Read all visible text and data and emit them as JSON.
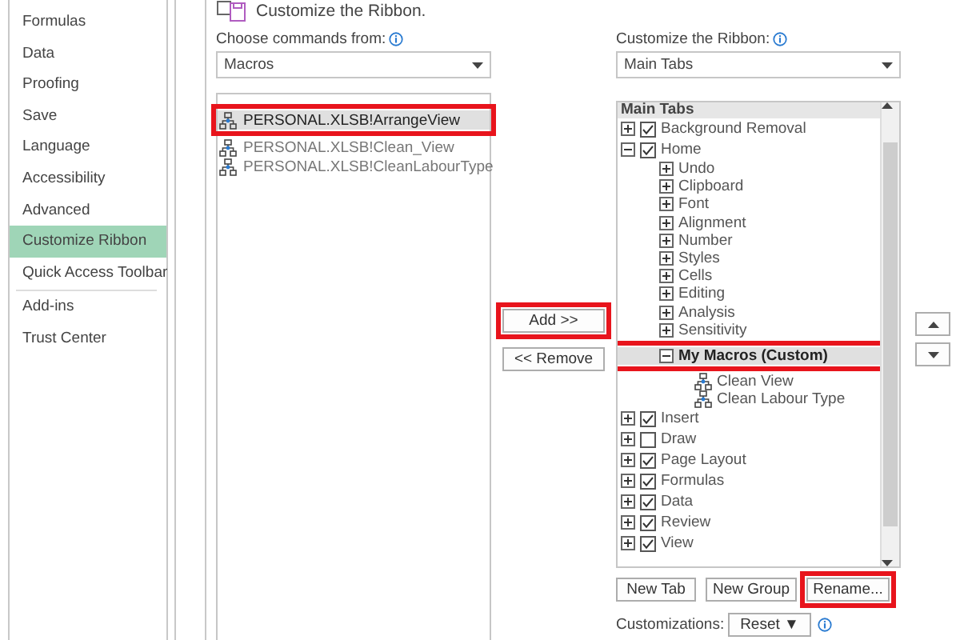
{
  "sidebar": {
    "items": [
      {
        "label": "Formulas",
        "selected": false
      },
      {
        "label": "Data",
        "selected": false
      },
      {
        "label": "Proofing",
        "selected": false
      },
      {
        "label": "Save",
        "selected": false
      },
      {
        "label": "Language",
        "selected": false
      },
      {
        "label": "Accessibility",
        "selected": false
      },
      {
        "label": "Advanced",
        "selected": false
      },
      {
        "label": "Customize Ribbon",
        "selected": true
      },
      {
        "label": "Quick Access Toolbar",
        "selected": false
      },
      {
        "label": "Add-ins",
        "selected": false
      },
      {
        "label": "Trust Center",
        "selected": false
      }
    ]
  },
  "header": {
    "title": "Customize the Ribbon."
  },
  "commands": {
    "label": "Choose commands from:",
    "dropdown": "Macros",
    "items": [
      {
        "label": "PERSONAL.XLSB!ArrangeView",
        "selected": true,
        "highlighted": true
      },
      {
        "label": "PERSONAL.XLSB!Clean_View",
        "selected": false,
        "highlighted": false
      },
      {
        "label": "PERSONAL.XLSB!CleanLabourType",
        "selected": false,
        "highlighted": false
      }
    ]
  },
  "transfer": [
    {
      "label": "Add >>",
      "highlighted": true
    },
    {
      "label": "<< Remove",
      "highlighted": false
    }
  ],
  "ribbon": {
    "label": "Customize the Ribbon:",
    "dropdown": "Main Tabs",
    "tree_header": "Main Tabs",
    "items": [
      {
        "kind": "tab",
        "label": "Background Removal",
        "checked": true,
        "expanded": false,
        "selected": false,
        "highlighted": false
      },
      {
        "kind": "tab",
        "label": "Home",
        "checked": true,
        "expanded": true,
        "selected": false,
        "highlighted": false,
        "children": [
          {
            "kind": "group",
            "label": "Undo",
            "expanded": false,
            "selected": false,
            "highlighted": false
          },
          {
            "kind": "group",
            "label": "Clipboard",
            "expanded": false,
            "selected": false,
            "highlighted": false
          },
          {
            "kind": "group",
            "label": "Font",
            "expanded": false,
            "selected": false,
            "highlighted": false
          },
          {
            "kind": "group",
            "label": "Alignment",
            "expanded": false,
            "selected": false,
            "highlighted": false
          },
          {
            "kind": "group",
            "label": "Number",
            "expanded": false,
            "selected": false,
            "highlighted": false
          },
          {
            "kind": "group",
            "label": "Styles",
            "expanded": false,
            "selected": false,
            "highlighted": false
          },
          {
            "kind": "group",
            "label": "Cells",
            "expanded": false,
            "selected": false,
            "highlighted": false
          },
          {
            "kind": "group",
            "label": "Editing",
            "expanded": false,
            "selected": false,
            "highlighted": false
          },
          {
            "kind": "group",
            "label": "Analysis",
            "expanded": false,
            "selected": false,
            "highlighted": false
          },
          {
            "kind": "group",
            "label": "Sensitivity",
            "expanded": false,
            "selected": false,
            "highlighted": false
          },
          {
            "kind": "group",
            "label": "My Macros (Custom)",
            "expanded": true,
            "selected": true,
            "highlighted": true,
            "children": [
              {
                "kind": "command",
                "label": "Clean View",
                "selected": false,
                "highlighted": false
              },
              {
                "kind": "command",
                "label": "Clean Labour Type",
                "selected": false,
                "highlighted": false
              }
            ]
          }
        ]
      },
      {
        "kind": "tab",
        "label": "Insert",
        "checked": true,
        "expanded": false,
        "selected": false,
        "highlighted": false
      },
      {
        "kind": "tab",
        "label": "Draw",
        "checked": false,
        "expanded": false,
        "selected": false,
        "highlighted": false
      },
      {
        "kind": "tab",
        "label": "Page Layout",
        "checked": true,
        "expanded": false,
        "selected": false,
        "highlighted": false
      },
      {
        "kind": "tab",
        "label": "Formulas",
        "checked": true,
        "expanded": false,
        "selected": false,
        "highlighted": false
      },
      {
        "kind": "tab",
        "label": "Data",
        "checked": true,
        "expanded": false,
        "selected": false,
        "highlighted": false
      },
      {
        "kind": "tab",
        "label": "Review",
        "checked": true,
        "expanded": false,
        "selected": false,
        "highlighted": false
      },
      {
        "kind": "tab",
        "label": "View",
        "checked": true,
        "expanded": false,
        "selected": false,
        "highlighted": false
      }
    ],
    "buttons": [
      {
        "label": "New Tab",
        "highlighted": false
      },
      {
        "label": "New Group",
        "highlighted": false
      },
      {
        "label": "Rename...",
        "highlighted": true
      }
    ],
    "customizations_label": "Customizations:",
    "reset": "Reset",
    "reset_caret": "▼"
  }
}
